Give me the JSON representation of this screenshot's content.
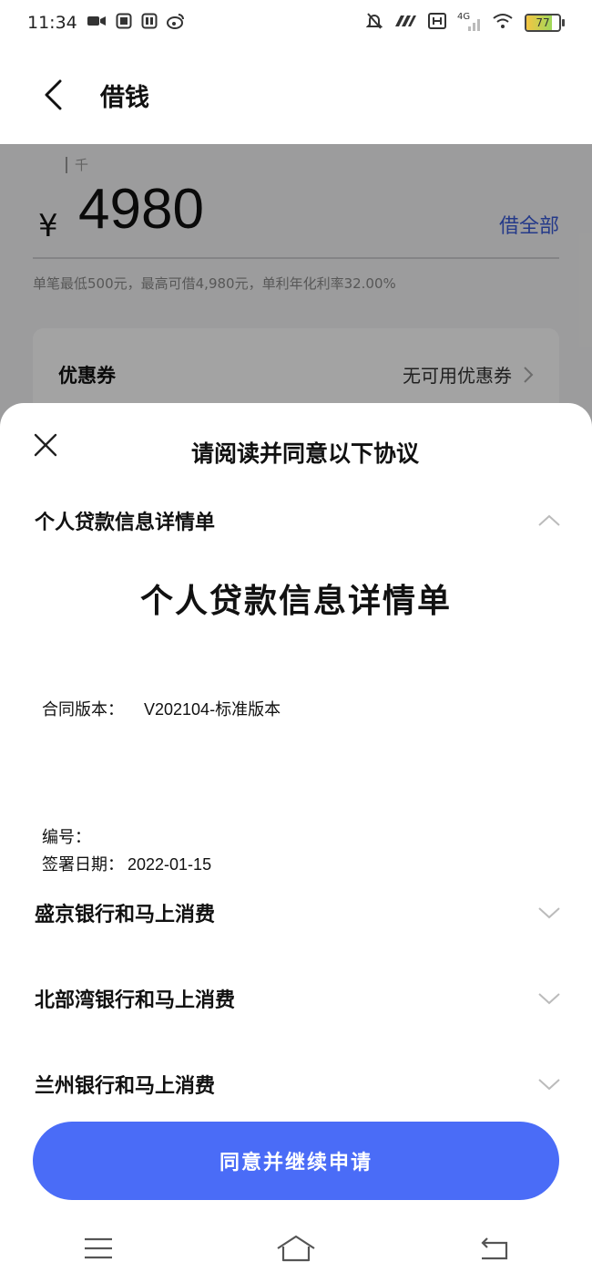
{
  "status_bar": {
    "time": "11:34",
    "left_icons": [
      "video-icon",
      "app-icon",
      "app-icon",
      "weibo-icon"
    ],
    "right_icons": [
      "mute-icon",
      "nfc-icon",
      "hd-icon",
      "signal-4g-icon",
      "wifi-icon"
    ],
    "network_label": "4G",
    "battery_level": "77",
    "battery_fraction": 0.77
  },
  "header": {
    "title": "借钱"
  },
  "amount": {
    "unit_hint": "千",
    "currency": "¥",
    "value": "4980",
    "borrow_all_label": "借全部",
    "note": "单笔最低500元，最高可借4,980元，单利年化利率32.00%"
  },
  "coupon": {
    "label": "优惠券",
    "value": "无可用优惠券"
  },
  "sheet": {
    "title": "请阅读并同意以下协议",
    "sections": [
      {
        "label": "个人贷款信息详情单",
        "expanded": true
      },
      {
        "label": "盛京银行和马上消费",
        "expanded": false
      },
      {
        "label": "北部湾银行和马上消费",
        "expanded": false
      },
      {
        "label": "兰州银行和马上消费",
        "expanded": false
      }
    ],
    "document": {
      "title": "个人贷款信息详情单",
      "contract_version_label": "合同版本：",
      "contract_version_value": "V202104-标准版本",
      "number_label": "编号：",
      "sign_date_label": "签署日期：",
      "sign_date_value": "2022-01-15"
    },
    "agree_button": "同意并继续申请"
  },
  "colors": {
    "accent": "#4a6cf7",
    "link": "#3b5bd6",
    "overlay": "rgba(0,0,0,0.36)"
  }
}
